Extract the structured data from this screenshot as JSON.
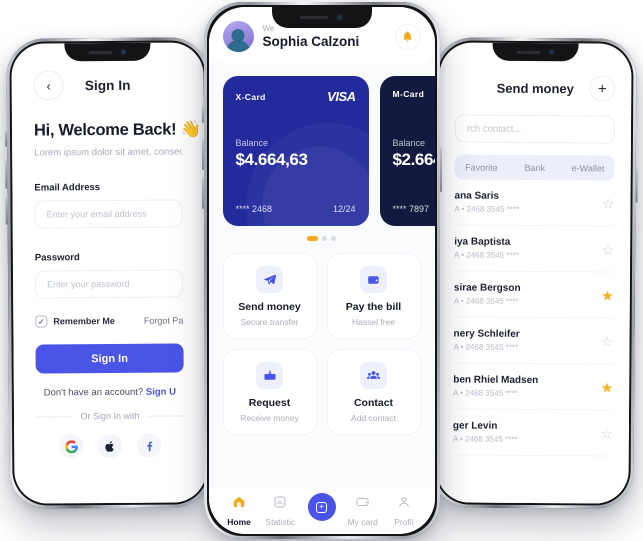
{
  "colors": {
    "indigo": "#4a55e8",
    "card_blue": "#222a9c",
    "card_dark": "#131a3f",
    "amber": "#f5a81c",
    "bg": "#fafbfd"
  },
  "signin": {
    "header_title": "Sign In",
    "back_icon": "chevron-left-icon",
    "welcome": "Hi, Welcome Back! 👋",
    "subtitle": "Lorem ipsum dolor sit amet, consectetur",
    "email_label": "Email Address",
    "email_placeholder": "Enter your email address",
    "password_label": "Password",
    "password_placeholder": "Enter your password",
    "remember_label": "Remember Me",
    "forgot_label": "Forgot Pa",
    "submit_label": "Sign In",
    "account_prompt": "Don't have an account? ",
    "signup_label": "Sign U",
    "or_label": "Or Sign In with",
    "socials": [
      {
        "name": "google-icon",
        "glyph": "G"
      },
      {
        "name": "apple-icon",
        "glyph": ""
      },
      {
        "name": "facebook-icon",
        "glyph": "f"
      }
    ]
  },
  "home": {
    "greeting": "We",
    "user_name": "Sophia Calzoni",
    "bell_icon": "bell-icon",
    "cards": [
      {
        "name": "X-Card",
        "brand": "VISA",
        "balance_label": "Balance",
        "balance": "$4.664,63",
        "masked": "**** 2468",
        "expiry": "12/24"
      },
      {
        "name": "M-Card",
        "brand": "",
        "balance_label": "Balance",
        "balance": "$2.664,",
        "masked": "**** 7897",
        "expiry": ""
      }
    ],
    "pager": {
      "count": 3,
      "active": 0
    },
    "actions": [
      {
        "title": "Send money",
        "subtitle": "Secure transfer",
        "icon": "send-icon"
      },
      {
        "title": "Pay the bill",
        "subtitle": "Hassel free",
        "icon": "wallet-icon"
      },
      {
        "title": "Request",
        "subtitle": "Receive money",
        "icon": "request-icon"
      },
      {
        "title": "Contact",
        "subtitle": "Add contact",
        "icon": "contacts-icon"
      }
    ],
    "tabs": [
      {
        "label": "Home",
        "icon": "home-icon",
        "active": true
      },
      {
        "label": "Statistic",
        "icon": "chart-icon",
        "active": false
      },
      {
        "label": "",
        "icon": "plus-icon",
        "active": false
      },
      {
        "label": "My card",
        "icon": "card-icon",
        "active": false
      },
      {
        "label": "Profil",
        "icon": "person-icon",
        "active": false
      }
    ]
  },
  "send": {
    "header_title": "Send money",
    "add_icon": "plus-icon",
    "search_placeholder": "rch contact...",
    "segments": [
      {
        "label": "Favorite"
      },
      {
        "label": "Bank"
      },
      {
        "label": "e-Wallet"
      }
    ],
    "contacts": [
      {
        "name": "ana Saris",
        "detail": "A • 2468 3545 ****",
        "favorite": false
      },
      {
        "name": "iya Baptista",
        "detail": "A • 2468 3545 ****",
        "favorite": false
      },
      {
        "name": "sirae Bergson",
        "detail": "A • 2468 3545 ****",
        "favorite": true
      },
      {
        "name": "nery Schleifer",
        "detail": "A • 2468 3545 ****",
        "favorite": false
      },
      {
        "name": "ben Rhiel Madsen",
        "detail": "A • 2468 3545 ****",
        "favorite": true
      },
      {
        "name": "ger Levin",
        "detail": "A • 2468 3545 ****",
        "favorite": false
      }
    ]
  }
}
